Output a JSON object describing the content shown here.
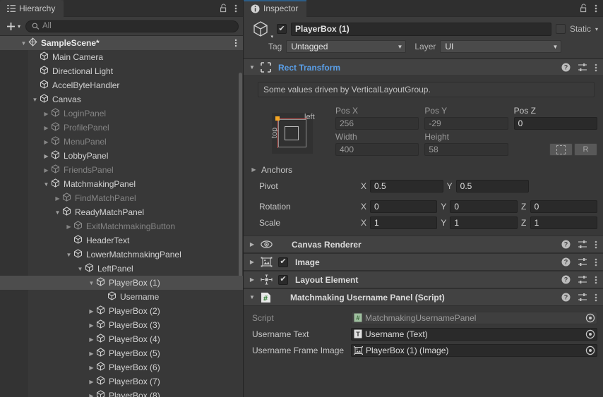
{
  "hierarchy": {
    "tab_label": "Hierarchy",
    "tab_icon": "hierarchy-icon",
    "lock_icon": "lock-open-icon",
    "menu_icon": "kebab-menu-icon",
    "toolbar": {
      "add_label": "+",
      "add_caret": "▾",
      "search_placeholder": "All",
      "search_value": "",
      "search_icon": "search-icon"
    },
    "rows": [
      {
        "label": "SampleScene*",
        "indent": 0,
        "tri": "▼",
        "icon": "scene-icon",
        "state": "scene",
        "kebab": true
      },
      {
        "label": "Main Camera",
        "indent": 1,
        "tri": "",
        "icon": "gameobject-icon",
        "state": "normal"
      },
      {
        "label": "Directional Light",
        "indent": 1,
        "tri": "",
        "icon": "gameobject-icon",
        "state": "normal"
      },
      {
        "label": "AccelByteHandler",
        "indent": 1,
        "tri": "",
        "icon": "gameobject-icon",
        "state": "normal"
      },
      {
        "label": "Canvas",
        "indent": 1,
        "tri": "▼",
        "icon": "gameobject-icon",
        "state": "normal"
      },
      {
        "label": "LoginPanel",
        "indent": 2,
        "tri": "▶",
        "icon": "gameobject-icon",
        "state": "disabled"
      },
      {
        "label": "ProfilePanel",
        "indent": 2,
        "tri": "▶",
        "icon": "gameobject-icon",
        "state": "disabled"
      },
      {
        "label": "MenuPanel",
        "indent": 2,
        "tri": "▶",
        "icon": "gameobject-icon",
        "state": "disabled"
      },
      {
        "label": "LobbyPanel",
        "indent": 2,
        "tri": "▶",
        "icon": "gameobject-icon",
        "state": "normal"
      },
      {
        "label": "FriendsPanel",
        "indent": 2,
        "tri": "▶",
        "icon": "gameobject-icon",
        "state": "disabled"
      },
      {
        "label": "MatchmakingPanel",
        "indent": 2,
        "tri": "▼",
        "icon": "gameobject-icon",
        "state": "normal"
      },
      {
        "label": "FindMatchPanel",
        "indent": 3,
        "tri": "▶",
        "icon": "gameobject-icon",
        "state": "disabled"
      },
      {
        "label": "ReadyMatchPanel",
        "indent": 3,
        "tri": "▼",
        "icon": "gameobject-icon",
        "state": "normal"
      },
      {
        "label": "ExitMatchmakingButton",
        "indent": 4,
        "tri": "▶",
        "icon": "gameobject-icon",
        "state": "disabled"
      },
      {
        "label": "HeaderText",
        "indent": 4,
        "tri": "",
        "icon": "gameobject-icon",
        "state": "normal"
      },
      {
        "label": "LowerMatchmakingPanel",
        "indent": 4,
        "tri": "▼",
        "icon": "gameobject-icon",
        "state": "normal"
      },
      {
        "label": "LeftPanel",
        "indent": 5,
        "tri": "▼",
        "icon": "gameobject-icon",
        "state": "normal"
      },
      {
        "label": "PlayerBox (1)",
        "indent": 6,
        "tri": "▼",
        "icon": "gameobject-icon",
        "state": "selected"
      },
      {
        "label": "Username",
        "indent": 7,
        "tri": "",
        "icon": "gameobject-icon",
        "state": "normal"
      },
      {
        "label": "PlayerBox (2)",
        "indent": 6,
        "tri": "▶",
        "icon": "gameobject-icon",
        "state": "normal"
      },
      {
        "label": "PlayerBox (3)",
        "indent": 6,
        "tri": "▶",
        "icon": "gameobject-icon",
        "state": "normal"
      },
      {
        "label": "PlayerBox (4)",
        "indent": 6,
        "tri": "▶",
        "icon": "gameobject-icon",
        "state": "normal"
      },
      {
        "label": "PlayerBox (5)",
        "indent": 6,
        "tri": "▶",
        "icon": "gameobject-icon",
        "state": "normal"
      },
      {
        "label": "PlayerBox (6)",
        "indent": 6,
        "tri": "▶",
        "icon": "gameobject-icon",
        "state": "normal"
      },
      {
        "label": "PlayerBox (7)",
        "indent": 6,
        "tri": "▶",
        "icon": "gameobject-icon",
        "state": "normal"
      },
      {
        "label": "PlayerBox (8)",
        "indent": 6,
        "tri": "▶",
        "icon": "gameobject-icon",
        "state": "normal"
      }
    ]
  },
  "inspector": {
    "tab_label": "Inspector",
    "tab_icon": "info-icon",
    "lock_icon": "lock-open-icon",
    "menu_icon": "kebab-menu-icon",
    "accent_color": "#2c5d87",
    "gameobject": {
      "icon": "gameobject-icon",
      "enabled": true,
      "name": "PlayerBox (1)",
      "static_label": "Static",
      "static_checked": false,
      "static_caret": "▾",
      "tag_label": "Tag",
      "tag_value": "Untagged",
      "layer_label": "Layer",
      "layer_value": "UI"
    },
    "components": [
      {
        "name": "Rect Transform",
        "icon": "rect-transform-icon",
        "expanded": true,
        "title_color": "#5a9fe8",
        "help_icon": "help-icon",
        "preset_icon": "preset-icon",
        "menu_icon": "kebab-menu-icon"
      },
      {
        "name": "Canvas Renderer",
        "icon": "eye-icon",
        "expanded": false,
        "has_checkbox": false,
        "help_icon": "help-icon",
        "preset_icon": "preset-icon",
        "menu_icon": "kebab-menu-icon"
      },
      {
        "name": "Image",
        "icon": "image-component-icon",
        "expanded": false,
        "has_checkbox": true,
        "checked": true,
        "help_icon": "help-icon",
        "preset_icon": "preset-icon",
        "menu_icon": "kebab-menu-icon"
      },
      {
        "name": "Layout Element",
        "icon": "layout-element-icon",
        "expanded": false,
        "has_checkbox": true,
        "checked": true,
        "help_icon": "help-icon",
        "preset_icon": "preset-icon",
        "menu_icon": "kebab-menu-icon"
      },
      {
        "name": "Matchmaking Username Panel (Script)",
        "icon": "csharp-script-icon",
        "expanded": true,
        "has_checkbox": false,
        "help_icon": "help-icon",
        "preset_icon": "preset-icon",
        "menu_icon": "kebab-menu-icon"
      }
    ],
    "rect_transform": {
      "info_text": "Some values driven by VerticalLayoutGroup.",
      "anchor_preset": {
        "label_left": "left",
        "label_top": "top",
        "pivot_color": "#f5a623",
        "anchor_color": "#c0504d"
      },
      "pos_x_label": "Pos X",
      "pos_x_value": "256",
      "pos_y_label": "Pos Y",
      "pos_y_value": "-29",
      "pos_z_label": "Pos Z",
      "pos_z_value": "0",
      "width_label": "Width",
      "width_value": "400",
      "height_label": "Height",
      "height_value": "58",
      "blueprint_button": "blueprint-mode-icon",
      "raw_button": "R",
      "anchors_label": "Anchors",
      "anchors_tri": "▶",
      "pivot_label": "Pivot",
      "pivot_x": "0.5",
      "pivot_y": "0.5",
      "rotation_label": "Rotation",
      "rotation_x": "0",
      "rotation_y": "0",
      "rotation_z": "0",
      "scale_label": "Scale",
      "scale_x": "1",
      "scale_y": "1",
      "scale_z": "1",
      "axis_x": "X",
      "axis_y": "Y",
      "axis_z": "Z"
    },
    "script_fields": [
      {
        "label": "Script",
        "value": "MatchmakingUsernamePanel",
        "value_icon": "csharp-script-icon",
        "dim": true,
        "picker_icon": "object-picker-icon"
      },
      {
        "label": "Username Text",
        "value": "Username (Text)",
        "value_icon": "text-component-icon",
        "dim": false,
        "picker_icon": "object-picker-icon"
      },
      {
        "label": "Username Frame Image",
        "value": "PlayerBox (1) (Image)",
        "value_icon": "image-component-icon",
        "dim": false,
        "picker_icon": "object-picker-icon"
      }
    ]
  }
}
